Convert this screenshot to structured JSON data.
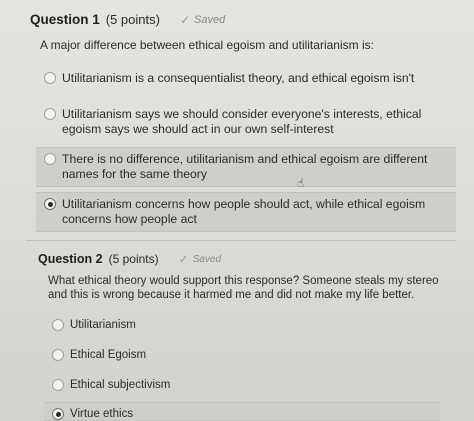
{
  "q1": {
    "title": "Question 1",
    "points": "(5 points)",
    "saved": "Saved",
    "prompt": "A major difference between ethical egoism and utilitarianism is:",
    "options": [
      "Utilitarianism is a consequentialist theory, and ethical egoism isn't",
      "Utilitarianism says we should consider everyone's interests, ethical egoism says we should act in our own self-interest",
      "There is no difference, utilitarianism and ethical egoism are different names for the same theory",
      "Utilitarianism concerns how people should act, while ethical egoism concerns how people act"
    ],
    "selected_index": 3
  },
  "q2": {
    "title": "Question 2",
    "points": "(5 points)",
    "saved": "Saved",
    "prompt": "What ethical theory would support this response? Someone steals my stereo and this is wrong because it harmed me and did not make my life better.",
    "options": [
      "Utilitarianism",
      "Ethical Egoism",
      "Ethical subjectivism",
      "Virtue ethics"
    ],
    "selected_index": 3
  },
  "icons": {
    "saved_check": "checkmark-icon",
    "cursor": "hand-pointer-icon"
  }
}
